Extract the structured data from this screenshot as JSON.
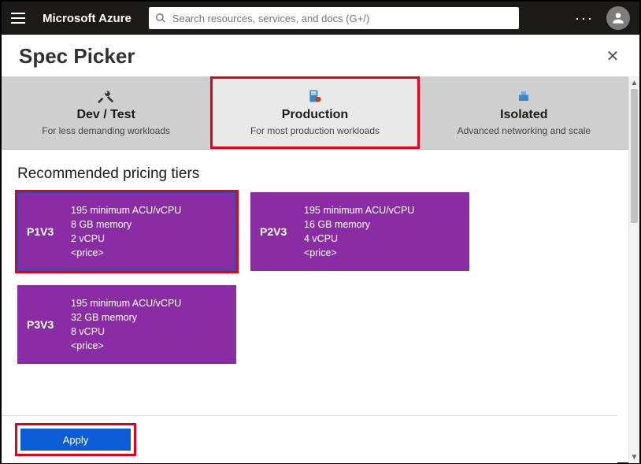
{
  "header": {
    "brand": "Microsoft Azure",
    "search_placeholder": "Search resources, services, and docs (G+/)"
  },
  "blade": {
    "title": "Spec Picker"
  },
  "tabs": [
    {
      "id": "devtest",
      "title": "Dev / Test",
      "subtitle": "For less demanding workloads",
      "active": false,
      "icon": "tools"
    },
    {
      "id": "production",
      "title": "Production",
      "subtitle": "For most production workloads",
      "active": true,
      "icon": "server",
      "highlighted": true
    },
    {
      "id": "isolated",
      "title": "Isolated",
      "subtitle": "Advanced networking and scale",
      "active": false,
      "icon": "box"
    }
  ],
  "section": {
    "heading": "Recommended pricing tiers"
  },
  "tiers": [
    {
      "sku": "P1V3",
      "acu": "195 minimum ACU/vCPU",
      "memory": "8 GB memory",
      "vcpu": "2 vCPU",
      "price": "<price>",
      "selected": true,
      "highlighted": true
    },
    {
      "sku": "P2V3",
      "acu": "195 minimum ACU/vCPU",
      "memory": "16 GB memory",
      "vcpu": "4 vCPU",
      "price": "<price>",
      "selected": false
    },
    {
      "sku": "P3V3",
      "acu": "195 minimum ACU/vCPU",
      "memory": "32 GB memory",
      "vcpu": "8 vCPU",
      "price": "<price>",
      "selected": false
    }
  ],
  "footer": {
    "apply_label": "Apply",
    "highlighted": true
  },
  "colors": {
    "tier_bg": "#8a2da5",
    "primary": "#0b5cd6",
    "highlight": "#e3001b"
  }
}
